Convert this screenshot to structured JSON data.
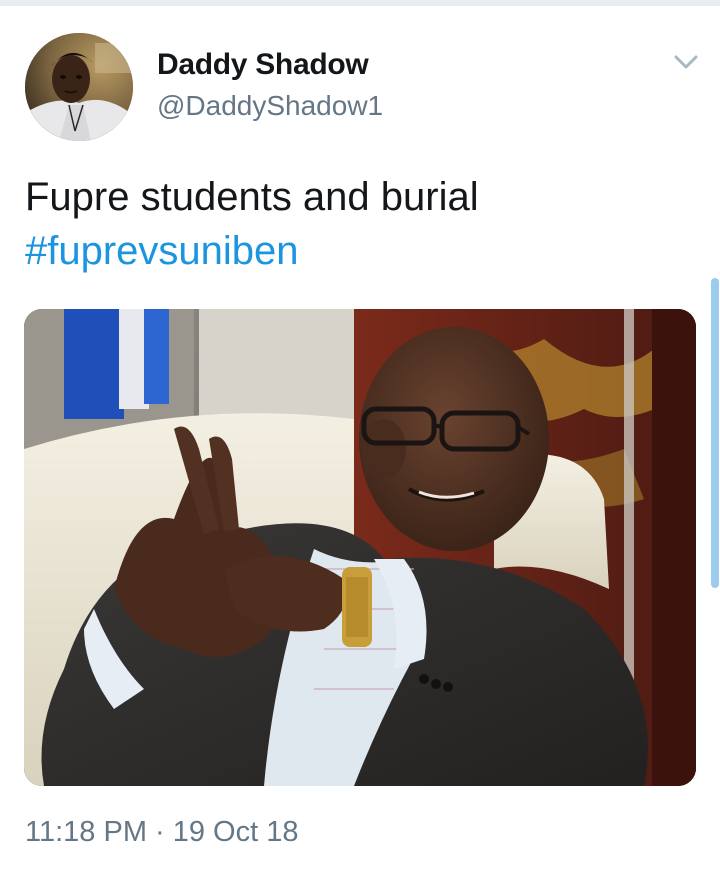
{
  "tweet": {
    "author": {
      "display_name": "Daddy Shadow",
      "handle": "@DaddyShadow1",
      "avatar_icon": "user-avatar-photo"
    },
    "text": "Fupre students and burial",
    "hashtag": "#fuprevsuniben",
    "media": {
      "kind": "photo",
      "icon": "tweet-photo"
    },
    "timestamp": "11:18 PM · 19 Oct 18",
    "menu_icon": "chevron-down-icon"
  },
  "colors": {
    "link": "#1b95e0",
    "text_primary": "#14171a",
    "text_secondary": "#657786",
    "divider": "#e6ecf0",
    "scrollbar": "#9ccbf0"
  }
}
